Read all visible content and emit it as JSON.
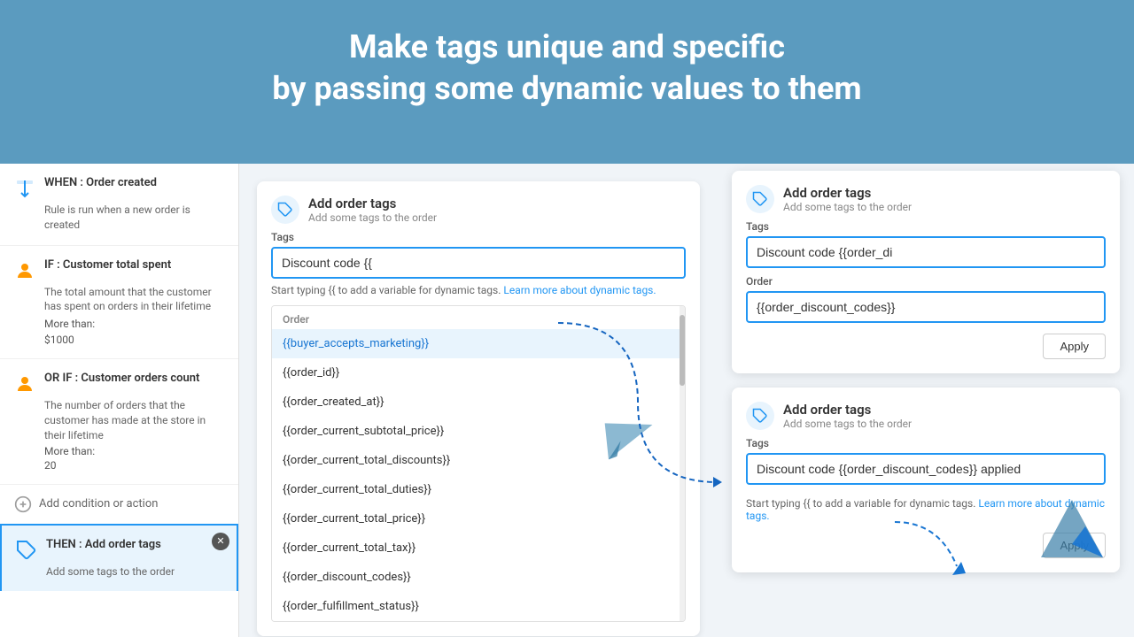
{
  "hero": {
    "line1": "Make tags unique and specific",
    "line2": "by passing some dynamic values to them"
  },
  "sidebar": {
    "when_label": "WHEN : Order created",
    "when_desc": "Rule is run when a new order is created",
    "if_label": "IF : Customer total spent",
    "if_desc": "The total amount that the customer has spent on orders in their lifetime",
    "if_detail1": "More than:",
    "if_detail2": "$1000",
    "orif_label": "OR IF : Customer orders count",
    "orif_desc": "The number of orders that the customer has made at the store in their lifetime",
    "orif_detail1": "More than:",
    "orif_detail2": "20",
    "add_label": "Add condition or action",
    "then_label": "THEN : Add order tags",
    "then_desc": "Add some tags to the order"
  },
  "center_card": {
    "title": "Add order tags",
    "subtitle": "Add some tags to the order",
    "tags_label": "Tags",
    "tags_value": "Discount code {{",
    "hint": "Start typing {{ to add a variable for dynamic tags.",
    "hint_link": "Learn more about dynamic tags.",
    "section_label": "Order",
    "dropdown_items": [
      {
        "id": "buyer_accepts_marketing",
        "value": "{{buyer_accepts_marketing}}",
        "selected": true
      },
      {
        "id": "order_id",
        "value": "{{order_id}}",
        "selected": false
      },
      {
        "id": "order_created_at",
        "value": "{{order_created_at}}",
        "selected": false
      },
      {
        "id": "order_current_subtotal_price",
        "value": "{{order_current_subtotal_price}}",
        "selected": false
      },
      {
        "id": "order_current_total_discounts",
        "value": "{{order_current_total_discounts}}",
        "selected": false
      },
      {
        "id": "order_current_total_duties",
        "value": "{{order_current_total_duties}}",
        "selected": false
      },
      {
        "id": "order_current_total_price",
        "value": "{{order_current_total_price}}",
        "selected": false
      },
      {
        "id": "order_current_total_tax",
        "value": "{{order_current_total_tax}}",
        "selected": false
      },
      {
        "id": "order_discount_codes",
        "value": "{{order_discount_codes}}",
        "selected": false
      },
      {
        "id": "order_fulfillment_status",
        "value": "{{order_fulfillment_status}}",
        "selected": false
      }
    ]
  },
  "right_card_top": {
    "title": "Add order tags",
    "subtitle": "Add some tags to the order",
    "tags_label": "Tags",
    "tags_value": "Discount code {{order_di",
    "section_label": "Order",
    "input_value": "{{order_discount_codes}}",
    "apply_label": "Apply"
  },
  "right_card_bottom": {
    "title": "Add order tags",
    "subtitle": "Add some tags to the order",
    "tags_label": "Tags",
    "tags_value": "Discount code {{order_discount_codes}} applied",
    "hint": "Start typing {{ to add a variable for dynamic tags.",
    "hint_link": "Learn more about dynamic tags.",
    "apply_label": "Apply"
  }
}
